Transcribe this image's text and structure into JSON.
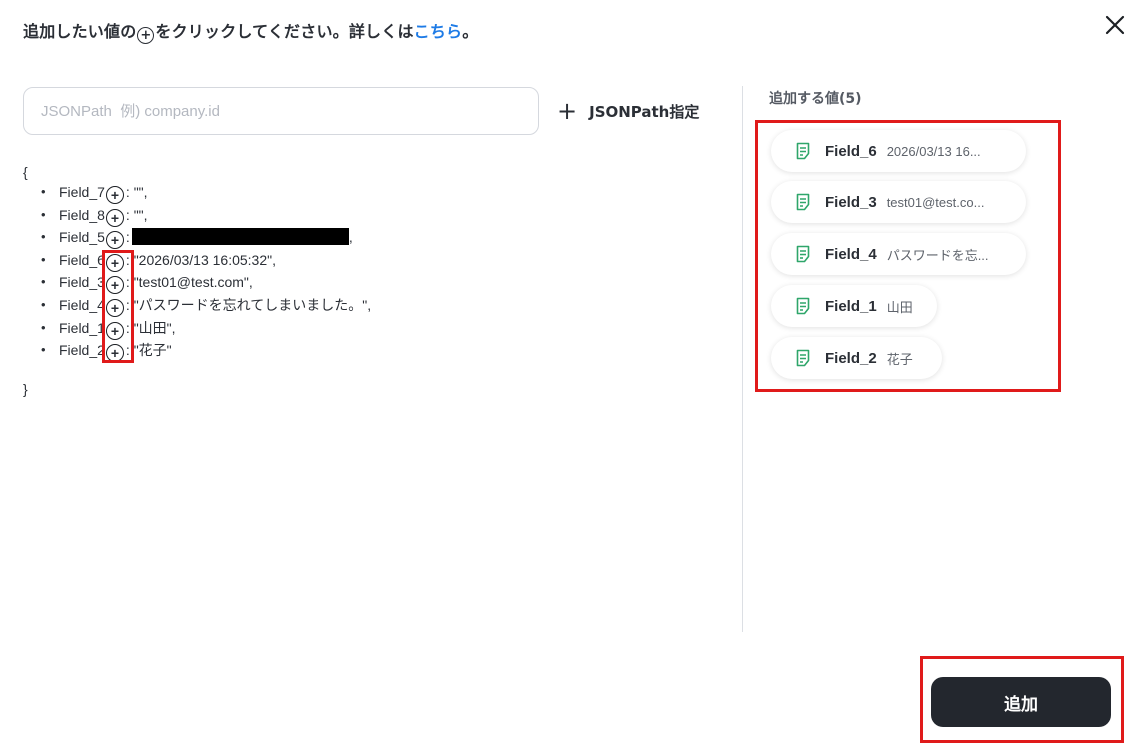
{
  "header": {
    "text_before": "追加したい値の",
    "plus_glyph": "+",
    "text_after": "をクリックしてください。詳しくは",
    "link_text": "こちら",
    "text_end": "。",
    "close_icon": "close-icon"
  },
  "search": {
    "placeholder": "JSONPath  例) company.id",
    "value": ""
  },
  "jsonpath_button": {
    "plus": "+",
    "label": "JSONPath指定"
  },
  "json_view": {
    "open_brace": "{",
    "close_brace": "}",
    "add_icon_glyph": "+",
    "items": [
      {
        "key": "Field_7",
        "value": ": \"\","
      },
      {
        "key": "Field_8",
        "value": ": \"\","
      },
      {
        "key": "Field_5",
        "value": ":",
        "redacted": true,
        "trail": ","
      },
      {
        "key": "Field_6",
        "value": ": \"2026/03/13 16:05:32\","
      },
      {
        "key": "Field_3",
        "value": ": \"test01@test.com\","
      },
      {
        "key": "Field_4",
        "value": ": \"パスワードを忘れてしまいました。\","
      },
      {
        "key": "Field_1",
        "value": ": \"山田\","
      },
      {
        "key": "Field_2",
        "value": ": \"花子\""
      }
    ]
  },
  "added_values": {
    "title": "追加する値(5)",
    "items": [
      {
        "name": "Field_6",
        "value": "2026/03/13 16..."
      },
      {
        "name": "Field_3",
        "value": "test01@test.co..."
      },
      {
        "name": "Field_4",
        "value": "パスワードを忘..."
      },
      {
        "name": "Field_1",
        "value": "山田"
      },
      {
        "name": "Field_2",
        "value": "花子"
      }
    ]
  },
  "footer": {
    "add_label": "追加"
  },
  "colors": {
    "link": "#1e7be6",
    "highlight": "#e01a1a",
    "primary_button": "#23272e",
    "field_icon": "#2fa66a"
  }
}
